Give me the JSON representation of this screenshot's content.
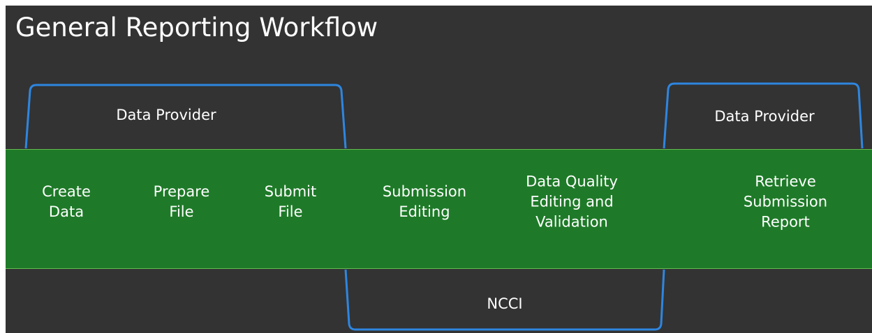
{
  "title": "General Reporting Workflow",
  "groups": [
    {
      "id": "provider-left",
      "label": "Data Provider"
    },
    {
      "id": "ncci",
      "label": "NCCI"
    },
    {
      "id": "provider-right",
      "label": "Data Provider"
    }
  ],
  "steps": [
    {
      "id": "create-data",
      "lines": [
        "Create",
        "Data"
      ]
    },
    {
      "id": "prepare-file",
      "lines": [
        "Prepare",
        "File"
      ]
    },
    {
      "id": "submit-file",
      "lines": [
        "Submit",
        "File"
      ]
    },
    {
      "id": "submission-editing",
      "lines": [
        "Submission",
        "Editing"
      ]
    },
    {
      "id": "data-quality",
      "lines": [
        "Data Quality",
        "Editing  and",
        "Validation"
      ]
    },
    {
      "id": "retrieve-report",
      "lines": [
        "Retrieve",
        "Submission",
        "Report"
      ]
    }
  ],
  "colors": {
    "background": "#333333",
    "band": "#1e7a28",
    "bracket": "#2e86e0",
    "text": "#ffffff"
  }
}
